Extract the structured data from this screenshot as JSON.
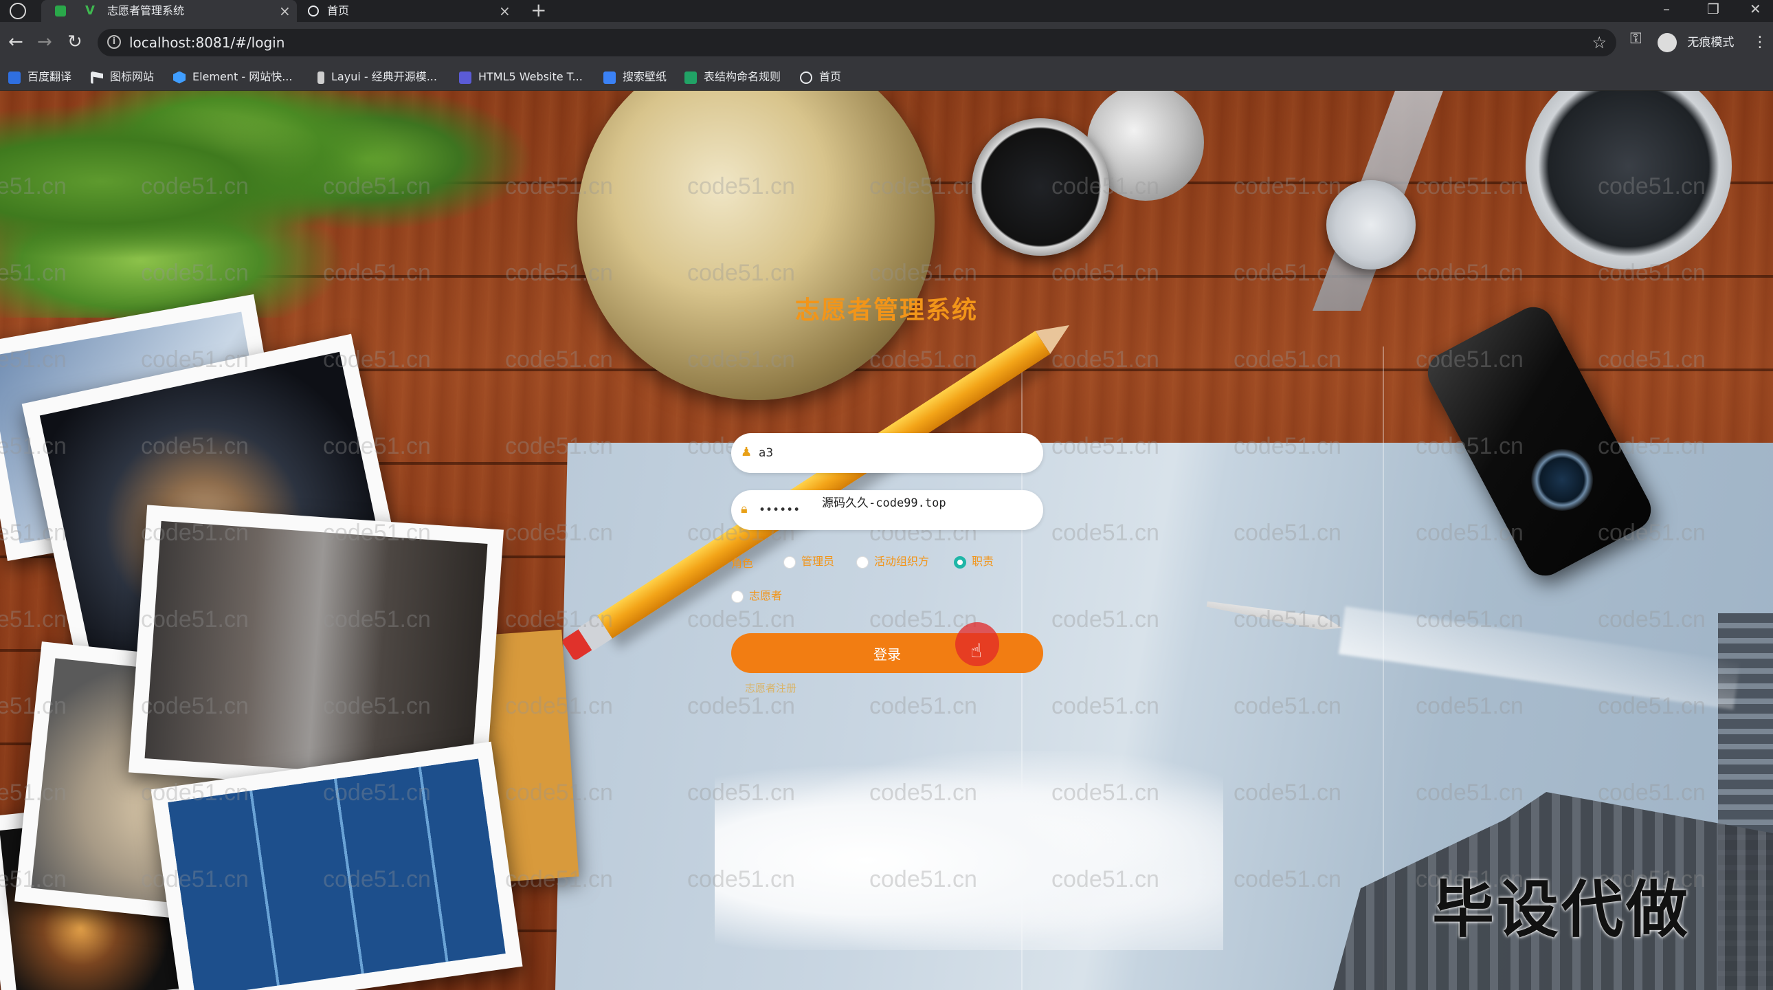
{
  "browser": {
    "tabs": [
      {
        "label": "志愿者管理系统",
        "active": true
      },
      {
        "label": "首页",
        "active": false
      }
    ],
    "address": "localhost:8081/#/login",
    "incognito_label": "无痕模式",
    "bookmarks": [
      {
        "label": "百度翻译",
        "icon": "baidu-translate-icon",
        "color": "#2f6fe0"
      },
      {
        "label": "图标网站",
        "icon": "flag-icon",
        "color": "#e8eaed"
      },
      {
        "label": "Element - 网站快...",
        "icon": "element-icon",
        "color": "#409eff"
      },
      {
        "label": "Layui - 经典开源模...",
        "icon": "layui-icon",
        "color": "#cfcfcf"
      },
      {
        "label": "HTML5 Website T...",
        "icon": "html5-template-icon",
        "color": "#5b5bd6"
      },
      {
        "label": "搜索壁纸",
        "icon": "wallpaper-icon",
        "color": "#3b82f6"
      },
      {
        "label": "表结构命名规则",
        "icon": "sheet-icon",
        "color": "#21a366"
      },
      {
        "label": "首页",
        "icon": "globe-icon",
        "color": "#e8eaed"
      }
    ]
  },
  "login": {
    "title": "志愿者管理系统",
    "username_value": "a3",
    "password_value": "••••••",
    "tooltip": "源码久久-code99.top",
    "role_label": "角色",
    "roles": [
      {
        "label": "管理员",
        "checked": false
      },
      {
        "label": "活动组织方",
        "checked": false
      },
      {
        "label": "职责",
        "checked": true
      },
      {
        "label": "志愿者",
        "checked": false
      }
    ],
    "submit_label": "登录",
    "register_link": "志愿者注册"
  },
  "watermark_text": "code51.cn",
  "overlay_stamp": "毕设代做",
  "colors": {
    "accent": "#f27d12",
    "title": "#f29519",
    "radio_checked": "#1fb6a7"
  }
}
